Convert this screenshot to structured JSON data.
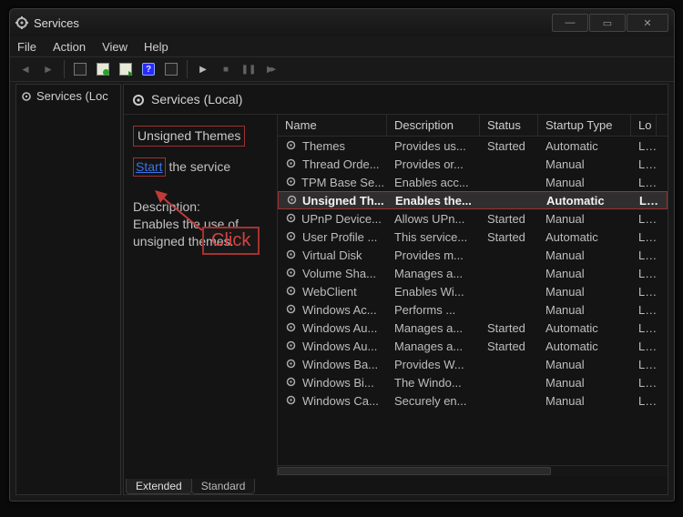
{
  "window": {
    "title": "Services"
  },
  "menu": {
    "file": "File",
    "action": "Action",
    "view": "View",
    "help": "Help"
  },
  "tree": {
    "root": "Services (Loc"
  },
  "pane": {
    "header": "Services (Local)",
    "selected_name": "Unsigned Themes",
    "start_link": "Start",
    "start_rest": " the service",
    "desc_label": "Description:",
    "desc_text": "Enables the use of unsigned themes."
  },
  "columns": {
    "name": "Name",
    "desc": "Description",
    "status": "Status",
    "startup": "Startup Type",
    "logon": "Lo"
  },
  "rows": [
    {
      "name": "Themes",
      "desc": "Provides us...",
      "status": "Started",
      "startup": "Automatic",
      "logon": "Lc"
    },
    {
      "name": "Thread Orde...",
      "desc": "Provides or...",
      "status": "",
      "startup": "Manual",
      "logon": "Lc"
    },
    {
      "name": "TPM Base Se...",
      "desc": "Enables acc...",
      "status": "",
      "startup": "Manual",
      "logon": "Lc"
    },
    {
      "name": "Unsigned Th...",
      "desc": "Enables the...",
      "status": "",
      "startup": "Automatic",
      "logon": "Lc",
      "selected": true
    },
    {
      "name": "UPnP Device...",
      "desc": "Allows UPn...",
      "status": "Started",
      "startup": "Manual",
      "logon": "Lc"
    },
    {
      "name": "User Profile ...",
      "desc": "This service...",
      "status": "Started",
      "startup": "Automatic",
      "logon": "Lc"
    },
    {
      "name": "Virtual Disk",
      "desc": "Provides m...",
      "status": "",
      "startup": "Manual",
      "logon": "Lc"
    },
    {
      "name": "Volume Sha...",
      "desc": "Manages a...",
      "status": "",
      "startup": "Manual",
      "logon": "Lc"
    },
    {
      "name": "WebClient",
      "desc": "Enables Wi...",
      "status": "",
      "startup": "Manual",
      "logon": "Lc"
    },
    {
      "name": "Windows Ac...",
      "desc": "Performs ...",
      "status": "",
      "startup": "Manual",
      "logon": "Lc"
    },
    {
      "name": "Windows Au...",
      "desc": "Manages a...",
      "status": "Started",
      "startup": "Automatic",
      "logon": "Lc"
    },
    {
      "name": "Windows Au...",
      "desc": "Manages a...",
      "status": "Started",
      "startup": "Automatic",
      "logon": "Lc"
    },
    {
      "name": "Windows Ba...",
      "desc": "Provides W...",
      "status": "",
      "startup": "Manual",
      "logon": "Lc"
    },
    {
      "name": "Windows Bi...",
      "desc": "The Windo...",
      "status": "",
      "startup": "Manual",
      "logon": "Lc"
    },
    {
      "name": "Windows Ca...",
      "desc": "Securely en...",
      "status": "",
      "startup": "Manual",
      "logon": "Lc"
    }
  ],
  "tabs": {
    "extended": "Extended",
    "standard": "Standard"
  },
  "annotation": {
    "click": "Click"
  }
}
